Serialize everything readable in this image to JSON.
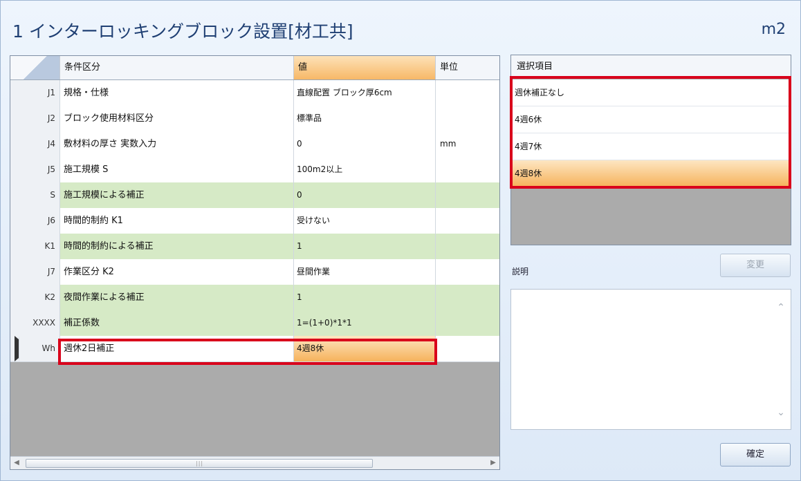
{
  "title": "1 インターロッキングブロック設置[材工共]",
  "unit": "m2",
  "grid": {
    "headers": {
      "condition": "条件区分",
      "value": "値",
      "unit": "単位"
    },
    "rows": [
      {
        "code": "J1",
        "condition": "規格・仕様",
        "value": "直線配置 ブロック厚6cm",
        "unit": "",
        "green": false
      },
      {
        "code": "J2",
        "condition": "ブロック使用材料区分",
        "value": "標準品",
        "unit": "",
        "green": false
      },
      {
        "code": "J4",
        "condition": "敷材料の厚さ 実数入力",
        "value": "0",
        "unit": "mm",
        "green": false
      },
      {
        "code": "J5",
        "condition": "施工規模 S",
        "value": "100m2以上",
        "unit": "",
        "green": false
      },
      {
        "code": "S",
        "condition": "施工規模による補正",
        "value": "0",
        "unit": "",
        "green": true
      },
      {
        "code": "J6",
        "condition": "時間的制約 K1",
        "value": "受けない",
        "unit": "",
        "green": false
      },
      {
        "code": "K1",
        "condition": "時間的制約による補正",
        "value": "1",
        "unit": "",
        "green": true
      },
      {
        "code": "J7",
        "condition": "作業区分 K2",
        "value": "昼間作業",
        "unit": "",
        "green": false
      },
      {
        "code": "K2",
        "condition": "夜間作業による補正",
        "value": "1",
        "unit": "",
        "green": true
      },
      {
        "code": "XXXX",
        "condition": "補正係数",
        "value": "1=(1+0)*1*1",
        "unit": "",
        "green": true
      },
      {
        "code": "Wh",
        "condition": "週休2日補正",
        "value": "4週8休",
        "unit": "",
        "green": false,
        "current": true
      }
    ]
  },
  "selection": {
    "header": "選択項目",
    "items": [
      "週休補正なし",
      "4週6休",
      "4週7休",
      "4週8休"
    ],
    "selected_index": 3
  },
  "buttons": {
    "change": "変更",
    "confirm": "確定"
  },
  "description_label": "説明",
  "colors": {
    "highlight_red": "#d9001b",
    "green_row": "#d6eac6",
    "selected_orange": "#f6b25b"
  }
}
